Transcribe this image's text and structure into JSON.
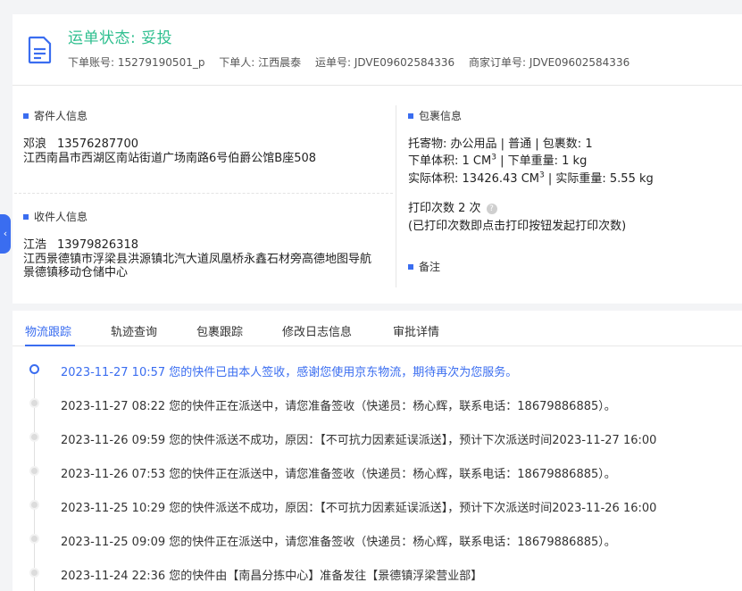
{
  "header": {
    "status_title": "运单状态: 妥投",
    "account": "下单账号: 15279190501_p",
    "orderer": "下单人: 江西晨泰",
    "waybill": "运单号: JDVE09602584336",
    "merchant_order": "商家订单号: JDVE09602584336"
  },
  "sender": {
    "title": "寄件人信息",
    "name": "邓浪",
    "phone": "13576287700",
    "address": "江西南昌市西湖区南站街道广场南路6号伯爵公馆B座508"
  },
  "receiver": {
    "title": "收件人信息",
    "name": "江浩",
    "phone": "13979826318",
    "address": "江西景德镇市浮梁县洪源镇北汽大道凤凰桥永鑫石材旁高德地图导航景德镇移动仓储中心"
  },
  "package": {
    "title": "包裹信息",
    "goods": "托寄物: 办公用品 | 普通 | 包裹数: 1",
    "order_volume_label": "下单体积:",
    "order_volume_value": "1 CM",
    "order_weight": "| 下单重量: 1 kg",
    "actual_volume_label": "实际体积:",
    "actual_volume_value": "13426.43 CM",
    "actual_weight": "| 实际重量: 5.55 kg",
    "superscript": "3",
    "print_count": "打印次数   2 次",
    "print_hint": "(已打印次数即点击打印按钮发起打印次数)",
    "help_glyph": "?"
  },
  "remark": {
    "title": "备注"
  },
  "side_tab": {
    "glyph": "‹"
  },
  "tabs": [
    {
      "label": "物流跟踪"
    },
    {
      "label": "轨迹查询"
    },
    {
      "label": "包裹跟踪"
    },
    {
      "label": "修改日志信息"
    },
    {
      "label": "审批详情"
    }
  ],
  "timeline": [
    {
      "text": "2023-11-27 10:57 您的快件已由本人签收，感谢您使用京东物流，期待再次为您服务。"
    },
    {
      "text": "2023-11-27 08:22 您的快件正在派送中，请您准备签收（快递员：杨心辉，联系电话：18679886885）。"
    },
    {
      "text": "2023-11-26 09:59 您的快件派送不成功，原因：【不可抗力因素延误派送】，预计下次派送时间2023-11-27 16:00"
    },
    {
      "text": "2023-11-26 07:53 您的快件正在派送中，请您准备签收（快递员：杨心辉，联系电话：18679886885）。"
    },
    {
      "text": "2023-11-25 10:29 您的快件派送不成功，原因：【不可抗力因素延误派送】，预计下次派送时间2023-11-26 16:00"
    },
    {
      "text": "2023-11-25 09:09 您的快件正在派送中，请您准备签收（快递员：杨心辉，联系电话：18679886885）。"
    },
    {
      "text": "2023-11-24 22:36 您的快件由【南昌分拣中心】准备发往【景德镇浮梁营业部】"
    }
  ],
  "colors": {
    "status_green": "#2fbf8f",
    "accent_blue": "#3a6df0"
  }
}
